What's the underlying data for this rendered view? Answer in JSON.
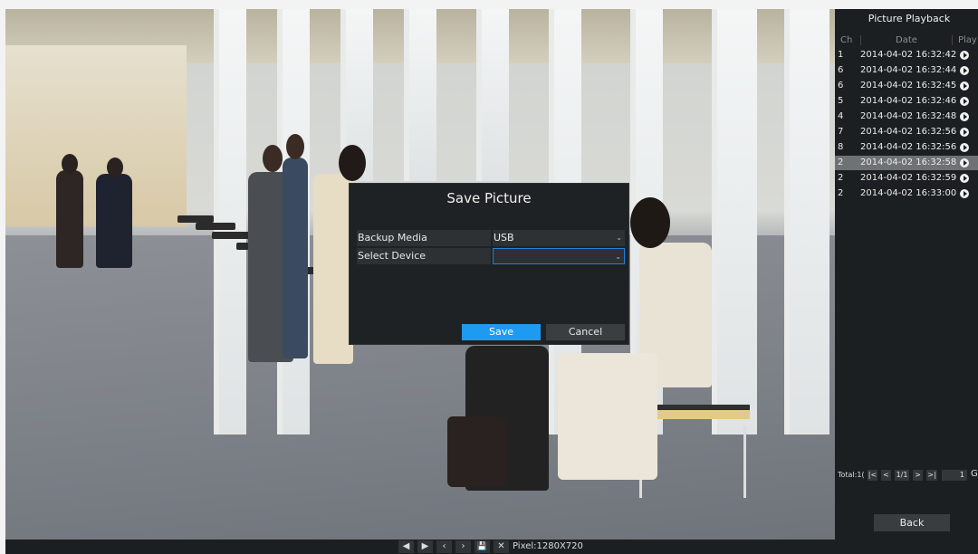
{
  "dialog": {
    "title": "Save Picture",
    "backup_media_label": "Backup Media",
    "backup_media_value": "USB",
    "select_device_label": "Select Device",
    "select_device_value": "",
    "save_label": "Save",
    "cancel_label": "Cancel"
  },
  "panel": {
    "title": "Picture Playback",
    "columns": {
      "ch": "Ch",
      "date": "Date",
      "play": "Play"
    },
    "rows": [
      {
        "ch": "1",
        "date": "2014-04-02 16:32:42"
      },
      {
        "ch": "6",
        "date": "2014-04-02 16:32:44"
      },
      {
        "ch": "6",
        "date": "2014-04-02 16:32:45"
      },
      {
        "ch": "5",
        "date": "2014-04-02 16:32:46"
      },
      {
        "ch": "4",
        "date": "2014-04-02 16:32:48"
      },
      {
        "ch": "7",
        "date": "2014-04-02 16:32:56"
      },
      {
        "ch": "8",
        "date": "2014-04-02 16:32:56"
      },
      {
        "ch": "2",
        "date": "2014-04-02 16:32:58",
        "selected": true
      },
      {
        "ch": "2",
        "date": "2014-04-02 16:32:59"
      },
      {
        "ch": "2",
        "date": "2014-04-02 16:33:00"
      }
    ],
    "pager": {
      "total": "Total:1(",
      "first": "|<",
      "prev": "<",
      "page": "1/1",
      "next": ">",
      "last": ">|",
      "goto_value": "1",
      "go_label": "G"
    },
    "back_label": "Back"
  },
  "toolbar": {
    "prev_icon": "◀",
    "play_icon": "▶",
    "step_back_icon": "‹",
    "step_forward_icon": "›",
    "save_icon": "💾",
    "close_icon": "✕",
    "pixel_label": "Pixel:1280X720"
  },
  "colors": {
    "accent": "#1e9bf0",
    "panel_bg": "#1c1f21",
    "selected_row": "#6e7275"
  }
}
